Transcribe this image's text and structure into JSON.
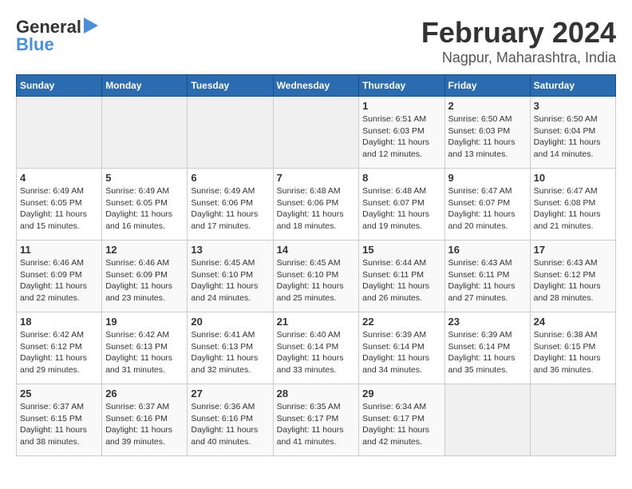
{
  "logo": {
    "general": "General",
    "blue": "Blue"
  },
  "title": "February 2024",
  "subtitle": "Nagpur, Maharashtra, India",
  "headers": [
    "Sunday",
    "Monday",
    "Tuesday",
    "Wednesday",
    "Thursday",
    "Friday",
    "Saturday"
  ],
  "weeks": [
    [
      {
        "day": "",
        "info": ""
      },
      {
        "day": "",
        "info": ""
      },
      {
        "day": "",
        "info": ""
      },
      {
        "day": "",
        "info": ""
      },
      {
        "day": "1",
        "info": "Sunrise: 6:51 AM\nSunset: 6:03 PM\nDaylight: 11 hours\nand 12 minutes."
      },
      {
        "day": "2",
        "info": "Sunrise: 6:50 AM\nSunset: 6:03 PM\nDaylight: 11 hours\nand 13 minutes."
      },
      {
        "day": "3",
        "info": "Sunrise: 6:50 AM\nSunset: 6:04 PM\nDaylight: 11 hours\nand 14 minutes."
      }
    ],
    [
      {
        "day": "4",
        "info": "Sunrise: 6:49 AM\nSunset: 6:05 PM\nDaylight: 11 hours\nand 15 minutes."
      },
      {
        "day": "5",
        "info": "Sunrise: 6:49 AM\nSunset: 6:05 PM\nDaylight: 11 hours\nand 16 minutes."
      },
      {
        "day": "6",
        "info": "Sunrise: 6:49 AM\nSunset: 6:06 PM\nDaylight: 11 hours\nand 17 minutes."
      },
      {
        "day": "7",
        "info": "Sunrise: 6:48 AM\nSunset: 6:06 PM\nDaylight: 11 hours\nand 18 minutes."
      },
      {
        "day": "8",
        "info": "Sunrise: 6:48 AM\nSunset: 6:07 PM\nDaylight: 11 hours\nand 19 minutes."
      },
      {
        "day": "9",
        "info": "Sunrise: 6:47 AM\nSunset: 6:07 PM\nDaylight: 11 hours\nand 20 minutes."
      },
      {
        "day": "10",
        "info": "Sunrise: 6:47 AM\nSunset: 6:08 PM\nDaylight: 11 hours\nand 21 minutes."
      }
    ],
    [
      {
        "day": "11",
        "info": "Sunrise: 6:46 AM\nSunset: 6:09 PM\nDaylight: 11 hours\nand 22 minutes."
      },
      {
        "day": "12",
        "info": "Sunrise: 6:46 AM\nSunset: 6:09 PM\nDaylight: 11 hours\nand 23 minutes."
      },
      {
        "day": "13",
        "info": "Sunrise: 6:45 AM\nSunset: 6:10 PM\nDaylight: 11 hours\nand 24 minutes."
      },
      {
        "day": "14",
        "info": "Sunrise: 6:45 AM\nSunset: 6:10 PM\nDaylight: 11 hours\nand 25 minutes."
      },
      {
        "day": "15",
        "info": "Sunrise: 6:44 AM\nSunset: 6:11 PM\nDaylight: 11 hours\nand 26 minutes."
      },
      {
        "day": "16",
        "info": "Sunrise: 6:43 AM\nSunset: 6:11 PM\nDaylight: 11 hours\nand 27 minutes."
      },
      {
        "day": "17",
        "info": "Sunrise: 6:43 AM\nSunset: 6:12 PM\nDaylight: 11 hours\nand 28 minutes."
      }
    ],
    [
      {
        "day": "18",
        "info": "Sunrise: 6:42 AM\nSunset: 6:12 PM\nDaylight: 11 hours\nand 29 minutes."
      },
      {
        "day": "19",
        "info": "Sunrise: 6:42 AM\nSunset: 6:13 PM\nDaylight: 11 hours\nand 31 minutes."
      },
      {
        "day": "20",
        "info": "Sunrise: 6:41 AM\nSunset: 6:13 PM\nDaylight: 11 hours\nand 32 minutes."
      },
      {
        "day": "21",
        "info": "Sunrise: 6:40 AM\nSunset: 6:14 PM\nDaylight: 11 hours\nand 33 minutes."
      },
      {
        "day": "22",
        "info": "Sunrise: 6:39 AM\nSunset: 6:14 PM\nDaylight: 11 hours\nand 34 minutes."
      },
      {
        "day": "23",
        "info": "Sunrise: 6:39 AM\nSunset: 6:14 PM\nDaylight: 11 hours\nand 35 minutes."
      },
      {
        "day": "24",
        "info": "Sunrise: 6:38 AM\nSunset: 6:15 PM\nDaylight: 11 hours\nand 36 minutes."
      }
    ],
    [
      {
        "day": "25",
        "info": "Sunrise: 6:37 AM\nSunset: 6:15 PM\nDaylight: 11 hours\nand 38 minutes."
      },
      {
        "day": "26",
        "info": "Sunrise: 6:37 AM\nSunset: 6:16 PM\nDaylight: 11 hours\nand 39 minutes."
      },
      {
        "day": "27",
        "info": "Sunrise: 6:36 AM\nSunset: 6:16 PM\nDaylight: 11 hours\nand 40 minutes."
      },
      {
        "day": "28",
        "info": "Sunrise: 6:35 AM\nSunset: 6:17 PM\nDaylight: 11 hours\nand 41 minutes."
      },
      {
        "day": "29",
        "info": "Sunrise: 6:34 AM\nSunset: 6:17 PM\nDaylight: 11 hours\nand 42 minutes."
      },
      {
        "day": "",
        "info": ""
      },
      {
        "day": "",
        "info": ""
      }
    ]
  ]
}
